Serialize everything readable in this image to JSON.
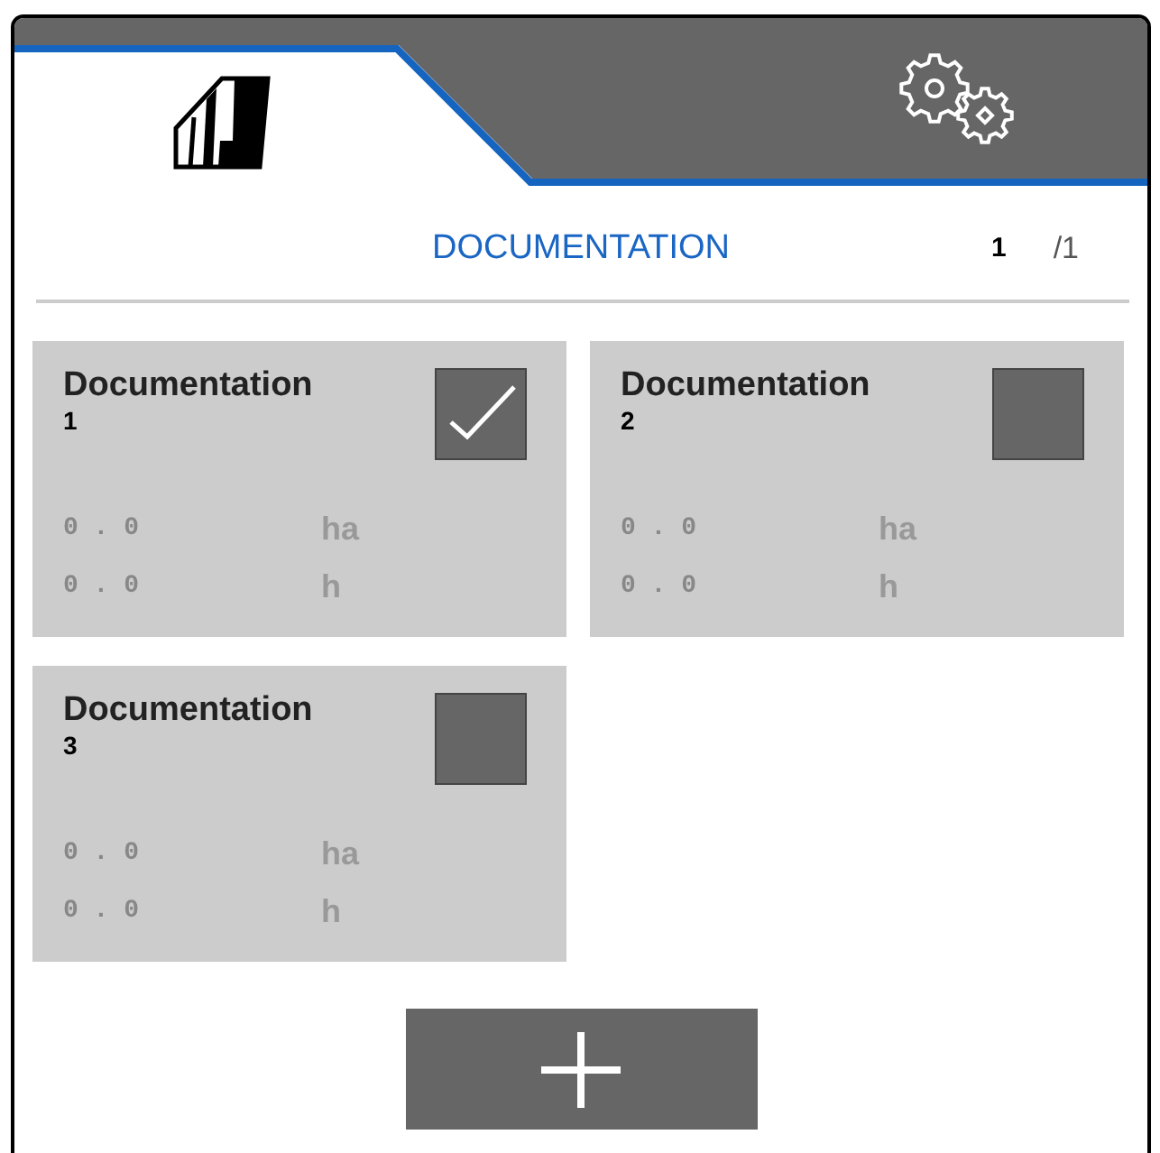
{
  "tabs": [
    {
      "kind": "field",
      "selected": true
    },
    {
      "kind": "settings",
      "selected": false
    }
  ],
  "title": "DOCUMENTATION",
  "pagination": {
    "current": "1",
    "total": "/1"
  },
  "documents": [
    {
      "title": "Documentation",
      "number": "1",
      "checked": true,
      "rows": [
        {
          "value": "0 . 0",
          "unit": "ha"
        },
        {
          "value": "0 . 0",
          "unit": "h"
        }
      ]
    },
    {
      "title": "Documentation",
      "number": "2",
      "checked": false,
      "rows": [
        {
          "value": "0 . 0",
          "unit": "ha"
        },
        {
          "value": "0 . 0",
          "unit": "h"
        }
      ]
    },
    {
      "title": "Documentation",
      "number": "3",
      "checked": false,
      "rows": [
        {
          "value": "0 . 0",
          "unit": "ha"
        },
        {
          "value": "0 . 0",
          "unit": "h"
        }
      ]
    }
  ]
}
